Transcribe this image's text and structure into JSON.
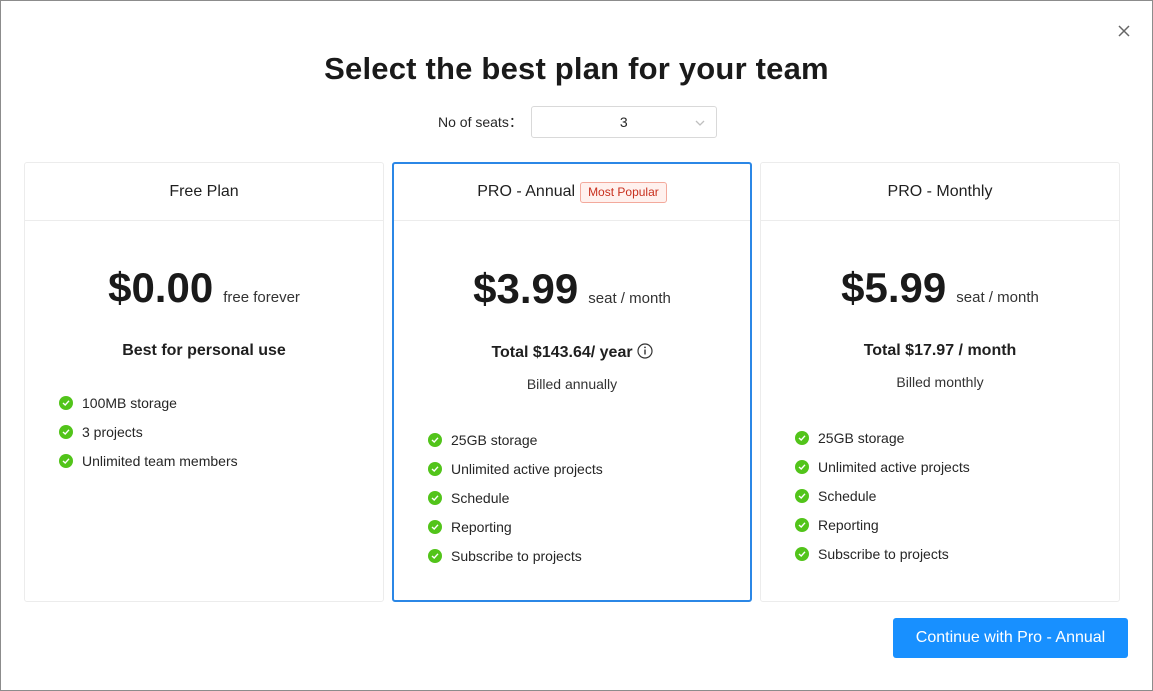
{
  "title": "Select the best plan for your team",
  "seats": {
    "label": "No of seats：",
    "value": "3"
  },
  "plans": [
    {
      "name": "Free Plan",
      "price": "$0.00",
      "per": "free forever",
      "subhead": "Best for personal use",
      "features": [
        "100MB storage",
        "3 projects",
        "Unlimited team members"
      ]
    },
    {
      "name": "PRO - Annual",
      "badge": "Most Popular",
      "price": "$3.99",
      "per": "seat / month",
      "subhead": "Total $143.64/ year",
      "billed": "Billed annually",
      "features": [
        "25GB storage",
        "Unlimited active projects",
        "Schedule",
        "Reporting",
        "Subscribe to projects"
      ]
    },
    {
      "name": "PRO - Monthly",
      "price": "$5.99",
      "per": "seat / month",
      "subhead": "Total $17.97 / month",
      "billed": "Billed monthly",
      "features": [
        "25GB storage",
        "Unlimited active projects",
        "Schedule",
        "Reporting",
        "Subscribe to projects"
      ]
    }
  ],
  "cta_label": "Continue with Pro - Annual",
  "colors": {
    "primary": "#1890ff",
    "selected_border": "#2b87e6",
    "check": "#52c41a",
    "badge_text": "#c8301e"
  },
  "icons": {
    "close": "close-icon",
    "dropdown": "chevron-down-icon",
    "info": "info-icon",
    "check": "check-circle-icon"
  }
}
